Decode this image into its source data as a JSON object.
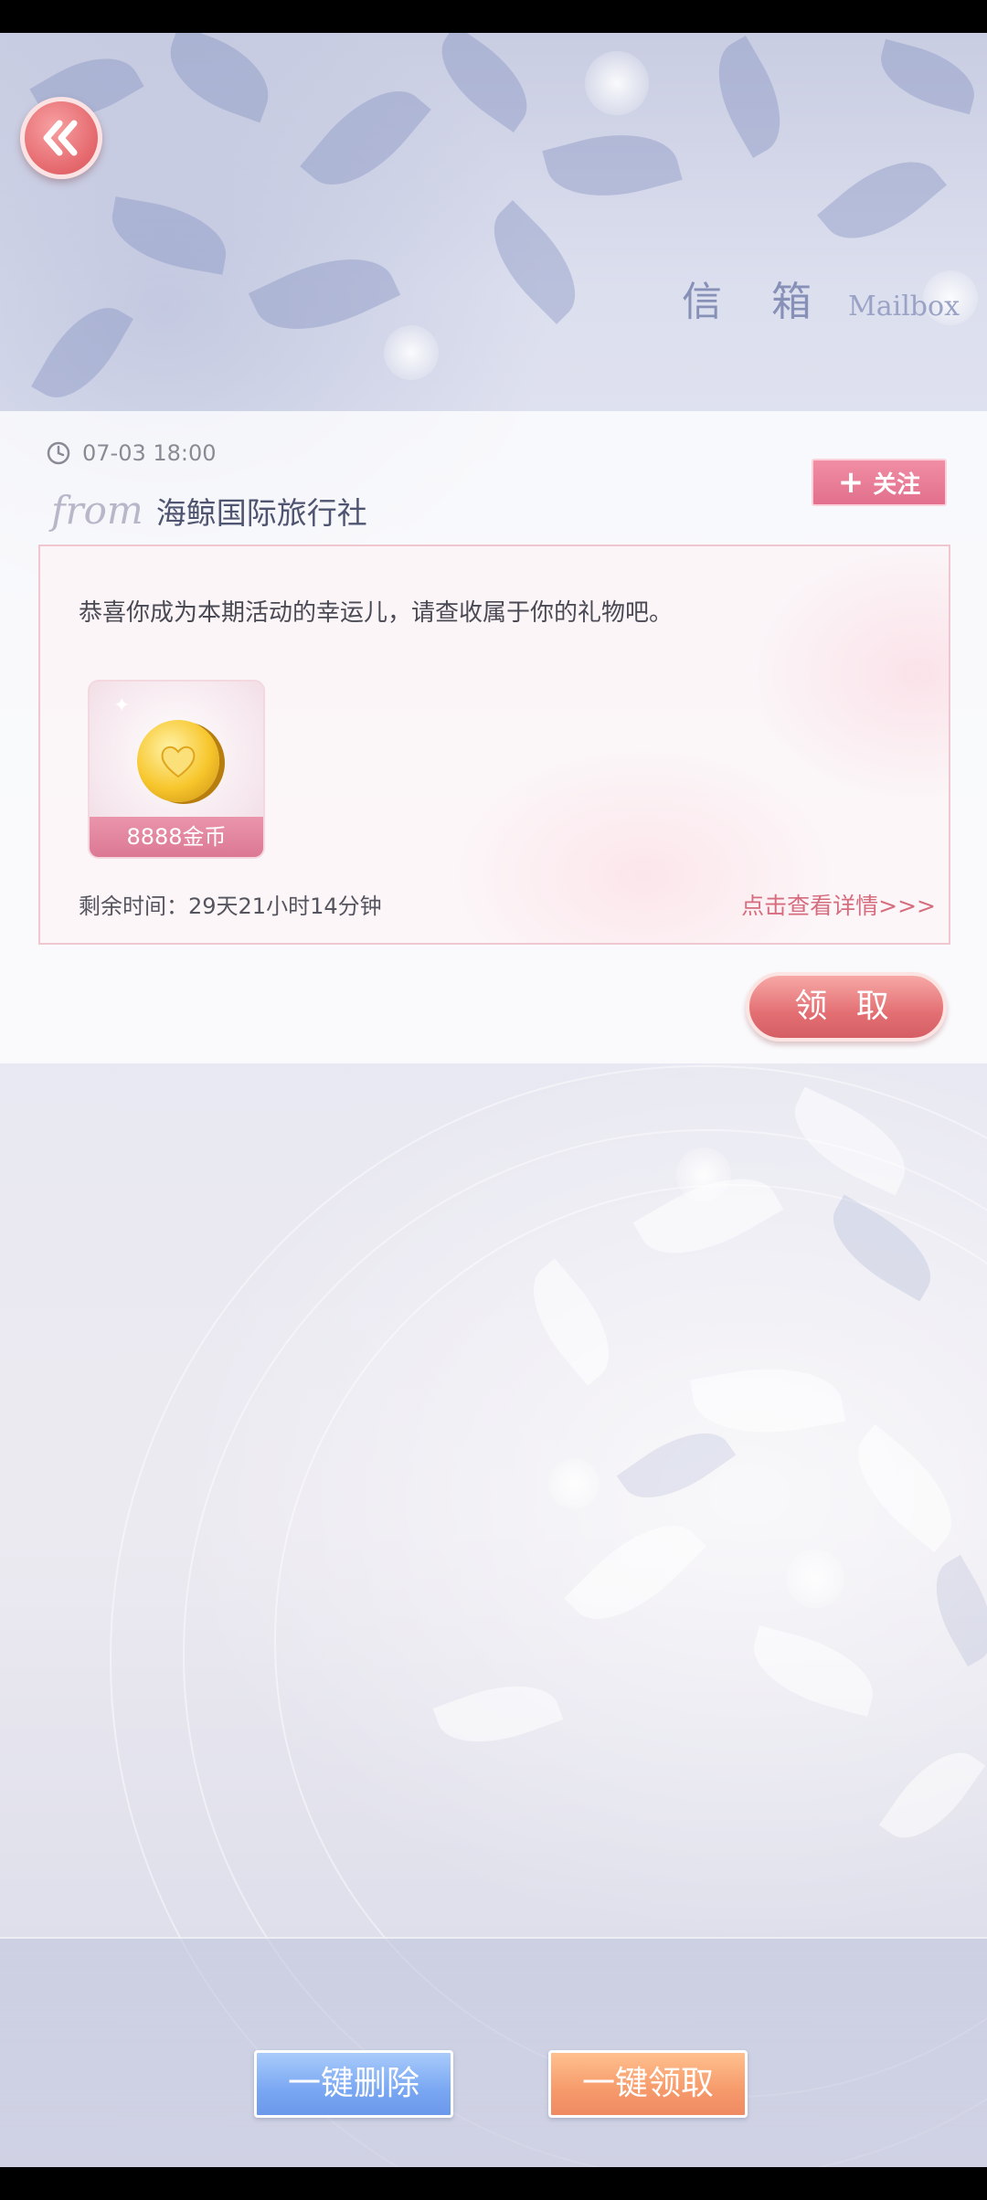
{
  "header": {
    "title": "信 箱",
    "subtitle": "Mailbox"
  },
  "mail": {
    "date": "07-03 18:00",
    "from_label": "from",
    "sender": "海鲸国际旅行社",
    "follow_label": "关注",
    "message": "恭喜你成为本期活动的幸运儿，请查收属于你的礼物吧。",
    "reward": {
      "icon": "gold-coin-icon",
      "label": "8888金币"
    },
    "remaining_time": "剩余时间：29天21小时14分钟",
    "details_link": "点击查看详情>>>",
    "claim_label": "领 取"
  },
  "footer": {
    "delete_all_label": "一键删除",
    "claim_all_label": "一键领取"
  },
  "colors": {
    "accent_pink": "#e26f8d",
    "claim_red": "#e36f73",
    "delete_blue": "#79a7f2",
    "claim_orange": "#f69a6b"
  }
}
